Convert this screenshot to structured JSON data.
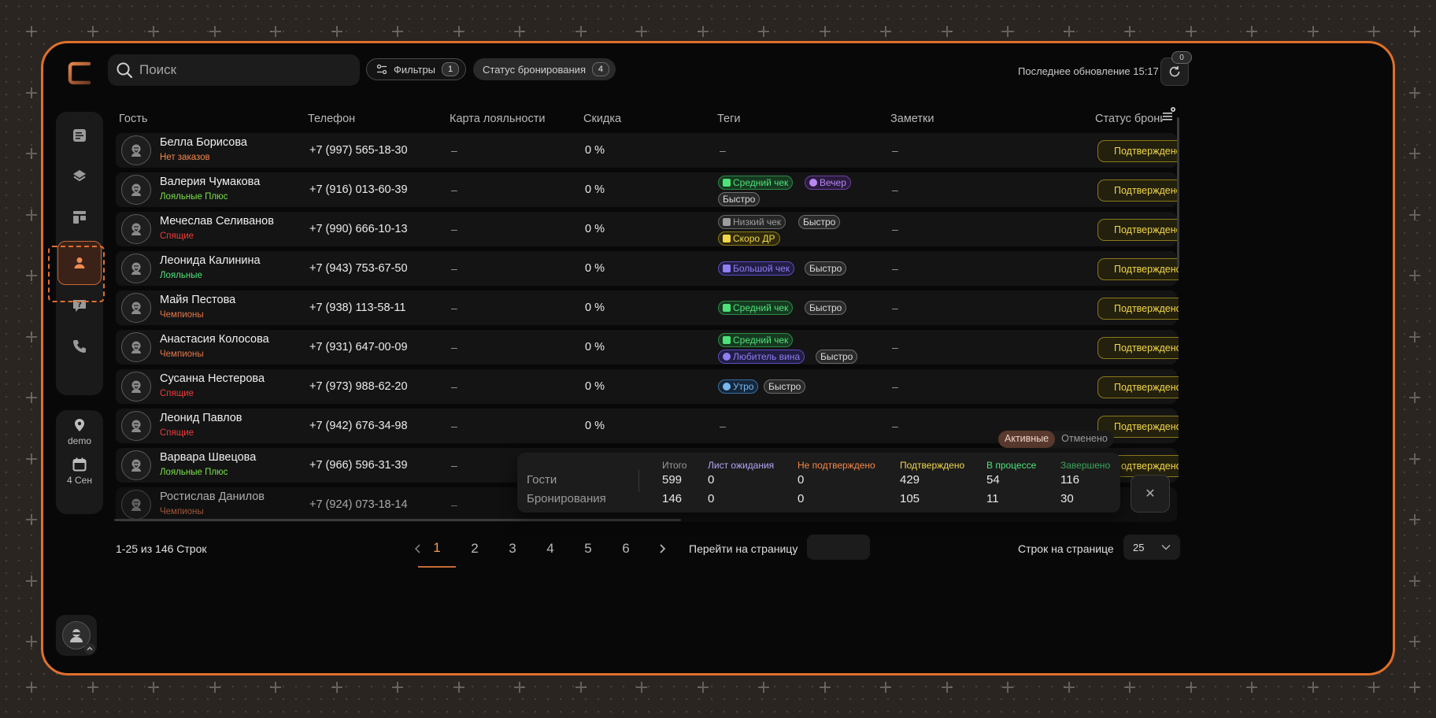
{
  "search": {
    "placeholder": "Поиск"
  },
  "filters": {
    "label": "Фильтры",
    "count": "1"
  },
  "booking_status": {
    "label": "Статус бронирования",
    "count": "4"
  },
  "last_update": "Последнее обновление 15:17",
  "refresh_badge": "0",
  "sidebar": {
    "location": "demo",
    "date": "4 Сен"
  },
  "columns": {
    "guest": "Гость",
    "phone": "Телефон",
    "loyalty": "Карта лояльности",
    "discount": "Скидка",
    "tags": "Теги",
    "notes": "Заметки",
    "status": "Статус брони"
  },
  "rows": [
    {
      "name": "Белла Борисова",
      "segment": "Нет заказов",
      "segment_color": "#f5874a",
      "phone": "+7 (997) 565-18-30",
      "loyalty": "–",
      "discount": "0 %",
      "tags_empty": "–",
      "notes": "–",
      "status": "Подтверждено"
    },
    {
      "name": "Валерия Чумакова",
      "segment": "Лояльные Плюс",
      "segment_color": "#7be04a",
      "phone": "+7 (916) 013-60-39",
      "loyalty": "–",
      "discount": "0 %",
      "tags": [
        "Средний чек",
        "Вечер",
        "Быстро"
      ],
      "notes": "–",
      "status": "Подтверждено"
    },
    {
      "name": "Мечеслав Селиванов",
      "segment": "Спящие",
      "segment_color": "#ef3b3b",
      "phone": "+7 (990) 666-10-13",
      "loyalty": "–",
      "discount": "0 %",
      "tags": [
        "Низкий чек",
        "Быстро",
        "Скоро ДР"
      ],
      "notes": "–",
      "status": "Подтверждено"
    },
    {
      "name": "Леонида Калинина",
      "segment": "Лояльные",
      "segment_color": "#4ee27a",
      "phone": "+7 (943) 753-67-50",
      "loyalty": "–",
      "discount": "0 %",
      "tags": [
        "Большой чек",
        "Быстро"
      ],
      "notes": "–",
      "status": "Подтверждено"
    },
    {
      "name": "Майя Пестова",
      "segment": "Чемпионы",
      "segment_color": "#e3774a",
      "phone": "+7 (938) 113-58-11",
      "loyalty": "–",
      "discount": "0 %",
      "tags": [
        "Средний чек",
        "Быстро"
      ],
      "notes": "–",
      "status": "Подтверждено"
    },
    {
      "name": "Анастасия Колосова",
      "segment": "Чемпионы",
      "segment_color": "#e3774a",
      "phone": "+7 (931) 647-00-09",
      "loyalty": "–",
      "discount": "0 %",
      "tags": [
        "Средний чек",
        "Любитель вина",
        "Быстро"
      ],
      "notes": "–",
      "status": "Подтверждено"
    },
    {
      "name": "Сусанна Нестерова",
      "segment": "Спящие",
      "segment_color": "#ef3b3b",
      "phone": "+7 (973) 988-62-20",
      "loyalty": "–",
      "discount": "0 %",
      "tags": [
        "Утро",
        "Быстро"
      ],
      "notes": "–",
      "status": "Подтверждено"
    },
    {
      "name": "Леонид Павлов",
      "segment": "Спящие",
      "segment_color": "#ef3b3b",
      "phone": "+7 (942) 676-34-98",
      "loyalty": "–",
      "discount": "0 %",
      "tags_empty": "–",
      "notes": "–",
      "status": "Подтверждено"
    },
    {
      "name": "Варвара Швецова",
      "segment": "Лояльные Плюс",
      "segment_color": "#7be04a",
      "phone": "+7 (966) 596-31-39",
      "loyalty": "–",
      "status": "Подтверждено"
    },
    {
      "name": "Ростислав Данилов",
      "segment": "Чемпионы",
      "segment_color": "#e3774a",
      "phone": "+7 (924) 073-18-14",
      "loyalty": "–"
    }
  ],
  "footer": {
    "range": "1-25 из 146 Строк",
    "pages": [
      "1",
      "2",
      "3",
      "4",
      "5",
      "6"
    ],
    "goto": "Перейти на страницу",
    "rows_per_page_label": "Строк на странице",
    "rows_per_page": "25"
  },
  "stats_toggle": {
    "active": "Активные",
    "cancelled": "Отменено"
  },
  "stats": {
    "headers": [
      {
        "label": "Итого",
        "color": "#9a9a9a"
      },
      {
        "label": "Лист ожидания",
        "color": "#b4a6f5"
      },
      {
        "label": "Не подтверждено",
        "color": "#f5874a"
      },
      {
        "label": "Подтверждено",
        "color": "#f2d74a"
      },
      {
        "label": "В процессе",
        "color": "#4ee27a"
      },
      {
        "label": "Завершено",
        "color": "#39a65a"
      }
    ],
    "guests": {
      "label": "Гости",
      "values": [
        "599",
        "0",
        "0",
        "429",
        "54",
        "116"
      ]
    },
    "bookings": {
      "label": "Бронирования",
      "values": [
        "146",
        "0",
        "0",
        "105",
        "11",
        "30"
      ]
    }
  }
}
